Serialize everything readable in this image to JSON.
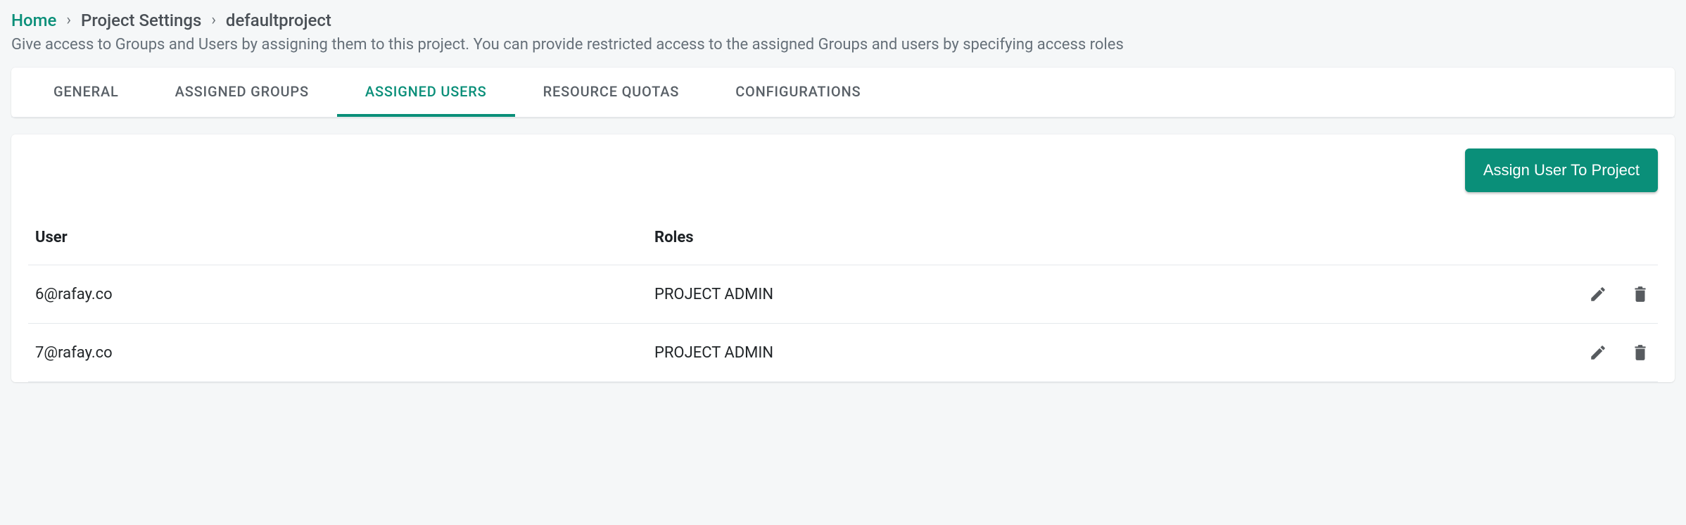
{
  "breadcrumb": {
    "home": "Home",
    "sep": "›",
    "crumbs": [
      "Project Settings",
      "defaultproject"
    ]
  },
  "description": "Give access to Groups and Users by assigning them to this project. You can provide restricted access to the assigned Groups and users by specifying access roles",
  "tabs": [
    {
      "label": "GENERAL",
      "active": false
    },
    {
      "label": "ASSIGNED GROUPS",
      "active": false
    },
    {
      "label": "ASSIGNED USERS",
      "active": true
    },
    {
      "label": "RESOURCE QUOTAS",
      "active": false
    },
    {
      "label": "CONFIGURATIONS",
      "active": false
    }
  ],
  "actions": {
    "assign_user_label": "Assign User To Project"
  },
  "table": {
    "headers": {
      "user": "User",
      "roles": "Roles"
    },
    "rows": [
      {
        "user": "6@rafay.co",
        "roles": "PROJECT ADMIN"
      },
      {
        "user": "7@rafay.co",
        "roles": "PROJECT ADMIN"
      }
    ]
  },
  "icons": {
    "edit": "pencil-icon",
    "delete": "trash-icon"
  }
}
